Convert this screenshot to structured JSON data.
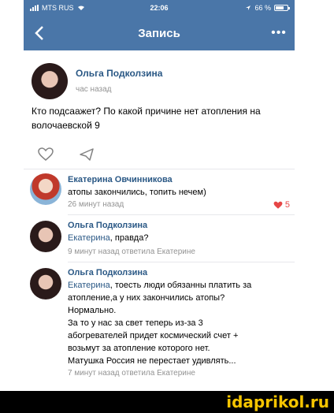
{
  "status_bar": {
    "carrier": "MTS RUS",
    "time": "22:06",
    "battery": "66 %"
  },
  "nav": {
    "back_icon": "chevron-left-icon",
    "title": "Запись",
    "more_label": "•••"
  },
  "post": {
    "author": "Ольга Подколзина",
    "time": "час назад",
    "text": "Кто подсаажет? По какой причине нет атопления на волочаевской 9",
    "actions": [
      "heart-icon",
      "share-icon"
    ]
  },
  "comments": [
    {
      "author": "Екатерина Овчинникова",
      "text": "атопы закончились, топить нечем)",
      "meta": "26 минут назад",
      "likes": "5"
    },
    {
      "author": "Ольга Подколзина",
      "mention": "Екатерина",
      "text": ", правда?",
      "meta": "9 минут назад ответила Екатерине"
    },
    {
      "author": "Ольга Подколзина",
      "mention": "Екатерина",
      "text_lines": [
        ", тоесть люди обязанны платить за",
        "атопление,а у них закончились атопы?",
        "Нормально.",
        "За то у нас за свет теперь из-за 3",
        "абогревателей придет космический счет +",
        "возьмут за атопление которого нет.",
        "Матушка Россия не перестает удивлять..."
      ],
      "meta": "7 минут назад ответила Екатерине"
    }
  ],
  "watermark": "idaprikol.ru",
  "colors": {
    "header": "#4a76a8",
    "link": "#2a5885",
    "meta": "#939393",
    "like": "#e64646",
    "watermark": "#f5c400"
  }
}
